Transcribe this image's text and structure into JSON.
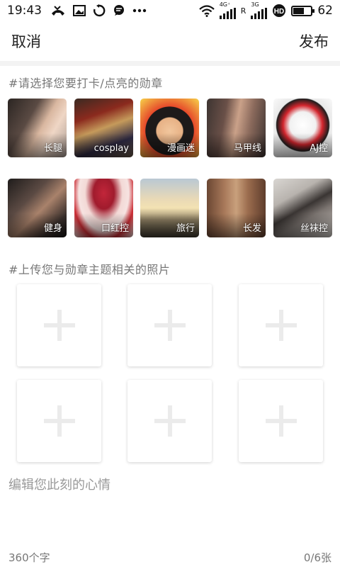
{
  "status_bar": {
    "time": "19:43",
    "network_1": "4G⁺",
    "network_2": "3G",
    "roaming": "R",
    "battery_level": "62",
    "battery_fraction": 0.62,
    "icons": [
      "missed-call-icon",
      "image-icon",
      "sync-icon",
      "chat-icon",
      "more-dots-icon",
      "wifi-icon",
      "signal-icon",
      "hd-icon",
      "battery-icon"
    ]
  },
  "header": {
    "cancel_label": "取消",
    "publish_label": "发布"
  },
  "badges": {
    "title": "#请选择您要打卡/点亮的勋章",
    "items": [
      {
        "label": "长腿"
      },
      {
        "label": "cosplay"
      },
      {
        "label": "漫画迷"
      },
      {
        "label": "马甲线"
      },
      {
        "label": "AJ控"
      },
      {
        "label": "健身"
      },
      {
        "label": "口红控"
      },
      {
        "label": "旅行"
      },
      {
        "label": "长发"
      },
      {
        "label": "丝袜控"
      }
    ]
  },
  "upload": {
    "title": "#上传您与勋章主题相关的照片",
    "slot_count": 6
  },
  "editor": {
    "placeholder": "编辑您此刻的心情"
  },
  "footer": {
    "char_limit": "360个字",
    "photo_count": "0/6张"
  }
}
